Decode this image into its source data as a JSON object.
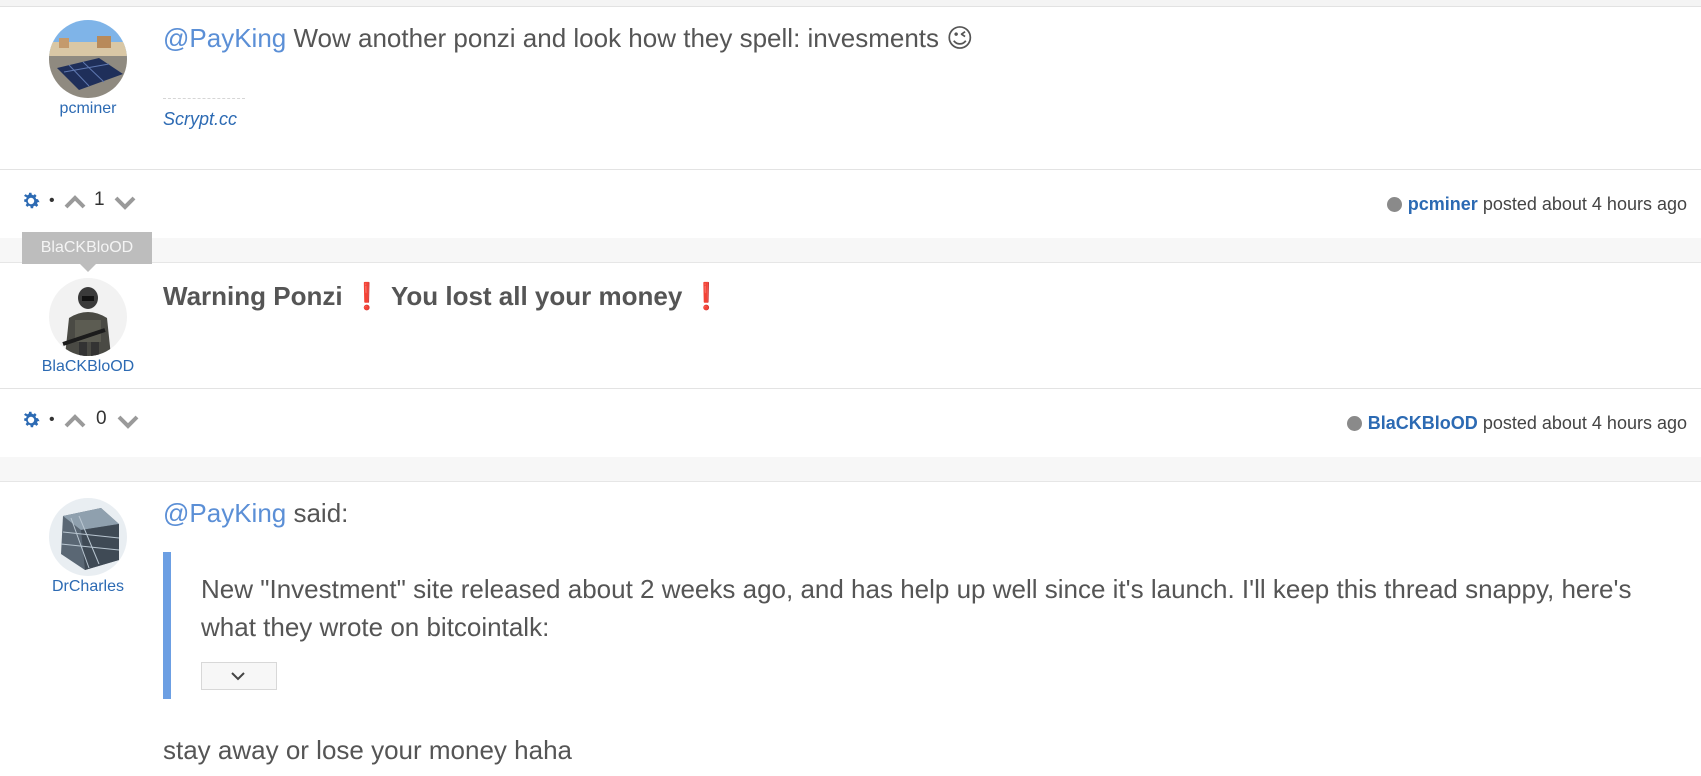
{
  "posts": [
    {
      "author": "pcminer",
      "mention": "@PayKing",
      "body": "Wow another ponzi and look how they spell: invesments",
      "emoji": "😉",
      "signature": "Scrypt.cc",
      "votes": "1",
      "meta_user": "pcminer",
      "meta_text": "posted about 4 hours ago"
    },
    {
      "author": "BlaCKBloOD",
      "tooltip": "BlaCKBloOD",
      "body_part1": "Warning Ponzi",
      "exclaim": "❗",
      "body_part2": "You lost all your money",
      "votes": "0",
      "meta_user": "BlaCKBloOD",
      "meta_text": "posted about 4 hours ago"
    },
    {
      "author": "DrCharles",
      "mention": "@PayKing",
      "said": "said:",
      "quote": "New \"Investment\" site released about 2 weeks ago, and has help up well since it's launch. I'll keep this thread snappy, here's what they wrote on bitcointalk:",
      "reply": "stay away or lose your money haha"
    }
  ],
  "colors": {
    "link": "#2c6ab3",
    "mention": "#5b8fd6",
    "quote_border": "#6c9fe3",
    "exclaim": "#d71e1e"
  },
  "icons": [
    "gear-icon",
    "chevron-up-icon",
    "chevron-down-icon",
    "status-dot-icon",
    "exclamation-icon",
    "wink-emoji-icon"
  ]
}
